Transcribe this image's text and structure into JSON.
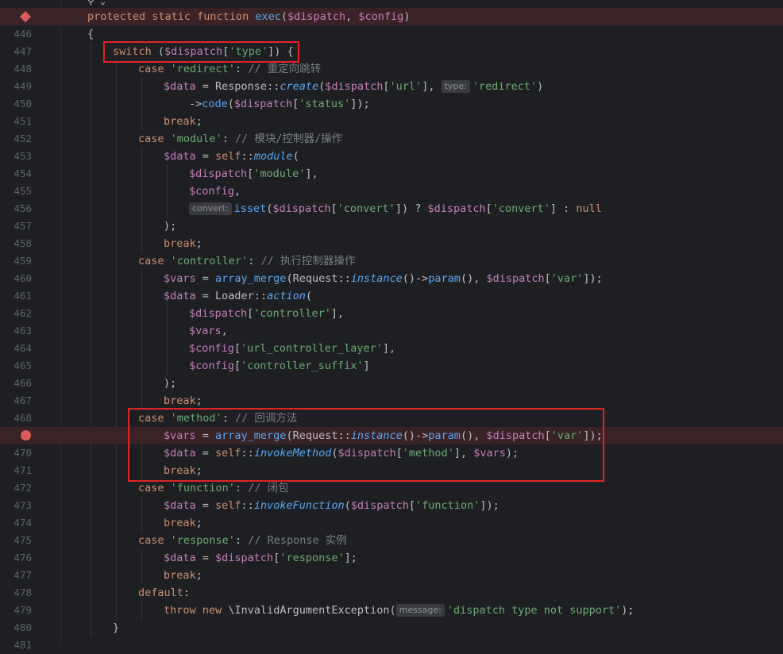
{
  "editor": {
    "top_icon": "⚲ ⌄",
    "header_line": {
      "kw1": "protected static function ",
      "fn": "exec",
      "p1": "(",
      "v1": "$dispatch",
      "p2": ", ",
      "v2": "$config",
      "p3": ")"
    },
    "line_numbers": [
      "446",
      "447",
      "448",
      "449",
      "450",
      "451",
      "452",
      "453",
      "454",
      "455",
      "456",
      "457",
      "458",
      "459",
      "460",
      "461",
      "462",
      "463",
      "464",
      "465",
      "466",
      "467",
      "468",
      "470",
      "471",
      "472",
      "473",
      "474",
      "475",
      "476",
      "477",
      "478",
      "479",
      "480",
      "481"
    ],
    "tokens": {
      "brace_open": "{",
      "brace_close": "}",
      "switch": "switch",
      "dispatch": "$dispatch",
      "type_key": "'type'",
      "case": "case",
      "break": "break",
      "default": "default",
      "throw": "throw",
      "new": "new",
      "self": "self",
      "data": "$data",
      "vars": "$vars",
      "config": "$config",
      "null": "null",
      "isset": "isset",
      "response_cls": "Response",
      "request_cls": "Request",
      "loader_cls": "Loader",
      "exc_cls": "\\InvalidArgumentException",
      "create": "create",
      "code": "code",
      "module_fn": "module",
      "array_merge": "array_merge",
      "instance": "instance",
      "param": "param",
      "action": "action",
      "invokeMethod": "invokeMethod",
      "invokeFunction": "invokeFunction",
      "s_redirect": "'redirect'",
      "s_url": "'url'",
      "s_status": "'status'",
      "s_module": "'module'",
      "s_convert": "'convert'",
      "s_controller": "'controller'",
      "s_var": "'var'",
      "s_url_controller_layer": "'url_controller_layer'",
      "s_controller_suffix": "'controller_suffix'",
      "s_method": "'method'",
      "s_function": "'function'",
      "s_response": "'response'",
      "s_msg": "'dispatch type not support'",
      "c_redirect": "// 重定向跳转",
      "c_module": "// 模块/控制器/操作",
      "c_controller": "// 执行控制器操作",
      "c_method": "// 回调方法",
      "c_function": "// 闭包",
      "c_response": "// Response 实例"
    },
    "hints": {
      "type": "type:",
      "convert": "convert:",
      "message": "message:"
    }
  },
  "colors": {
    "background": "#1e1f22",
    "keyword": "#cf8e6d",
    "variable": "#c77dbb",
    "string": "#6aab73",
    "function": "#56a8f5",
    "comment": "#7a7e85",
    "breakpoint": "#db5c5c",
    "highlight_box": "#e02424"
  }
}
